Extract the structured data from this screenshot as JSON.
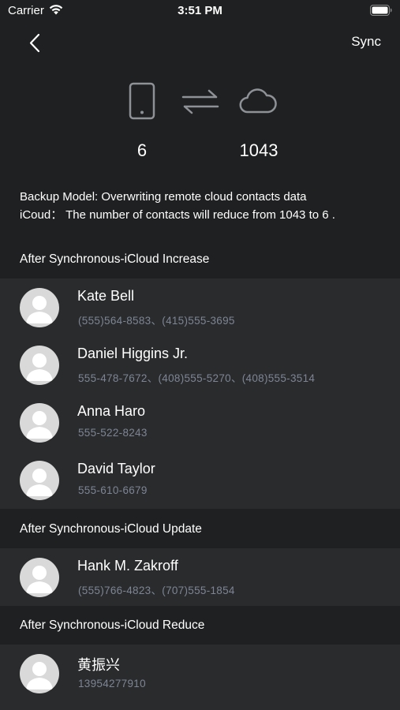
{
  "status_bar": {
    "carrier": "Carrier",
    "time": "3:51 PM"
  },
  "nav": {
    "back_icon": "chevron-left-icon",
    "sync_label": "Sync"
  },
  "sync_summary": {
    "local_icon": "phone-icon",
    "direction_icon": "swap-arrows-icon",
    "cloud_icon": "cloud-icon",
    "local_count": "6",
    "cloud_count": "1043"
  },
  "description": {
    "line1": "Backup Model: Overwriting remote cloud contacts data",
    "line2": "iCoud： The number of contacts will reduce from 1043 to 6 ."
  },
  "sections": {
    "increase": {
      "title": "After Synchronous-iCloud Increase",
      "contacts": [
        {
          "name": "Kate Bell",
          "phones": "(555)564-8583、(415)555-3695"
        },
        {
          "name": "Daniel Higgins Jr.",
          "phones": "555-478-7672、(408)555-5270、(408)555-3514"
        },
        {
          "name": "Anna Haro",
          "phones": "555-522-8243"
        },
        {
          "name": "David Taylor",
          "phones": "555-610-6679"
        }
      ]
    },
    "update": {
      "title": "After Synchronous-iCloud Update",
      "contacts": [
        {
          "name": "Hank M. Zakroff",
          "phones": "(555)766-4823、(707)555-1854"
        }
      ]
    },
    "reduce": {
      "title": "After Synchronous-iCloud Reduce",
      "contacts": [
        {
          "name": "黄振兴",
          "phones": "13954277910"
        }
      ]
    }
  },
  "colors": {
    "background": "#1f2021",
    "row_background": "#2a2b2d",
    "icon_gray": "#8e9196",
    "phone_text": "#7d8594",
    "avatar": "#d9d9d9"
  }
}
